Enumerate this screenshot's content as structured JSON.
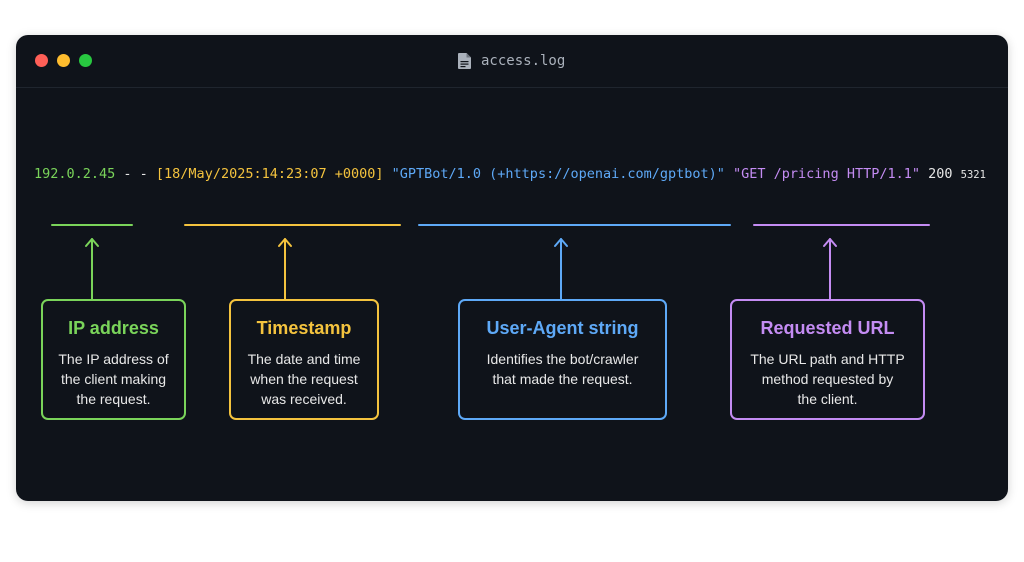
{
  "window": {
    "title": "access.log",
    "icon": "document-icon"
  },
  "log_line": {
    "ip": "192.0.2.45",
    "separator": " - - ",
    "timestamp": "[18/May/2025:14:23:07 +0000]",
    "user_agent": "\"GPTBot/1.0 (+https://openai.com/gptbot)\"",
    "request": "\"GET /pricing HTTP/1.1\"",
    "status": "200",
    "bytes": "5321"
  },
  "callouts": [
    {
      "title": "IP address",
      "description": "The IP address of\nthe client making\nthe request.",
      "color": "#7ad45a"
    },
    {
      "title": "Timestamp",
      "description": "The date and time\nwhen the request\nwas received.",
      "color": "#f4c33e"
    },
    {
      "title": "User-Agent string",
      "description": "Identifies the bot/crawler\nthat made the request.",
      "color": "#5ea9f7"
    },
    {
      "title": "Requested URL",
      "description": "The URL path and HTTP\nmethod requested by\nthe client.",
      "color": "#c48cf3"
    }
  ],
  "colors": {
    "background": "#ffffff",
    "window": "#0f131a",
    "text": "#e6e6e6",
    "traffic_red": "#ff5f57",
    "traffic_yellow": "#febc2e",
    "traffic_green": "#28c840"
  }
}
